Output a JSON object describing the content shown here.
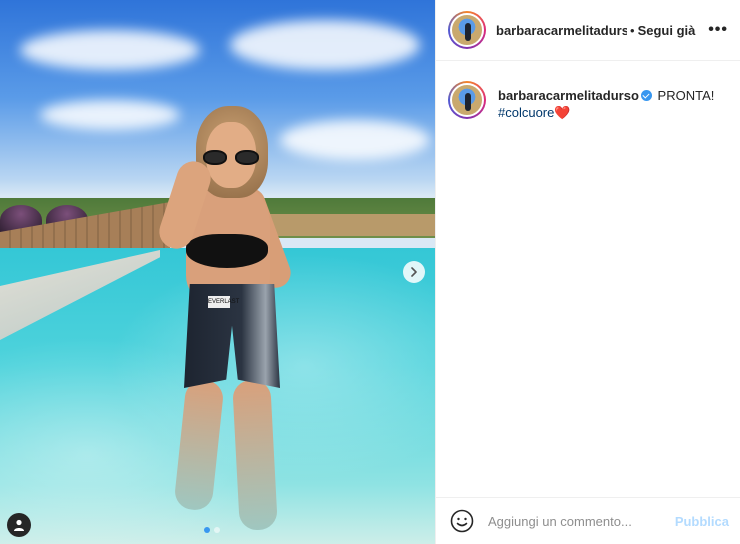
{
  "post": {
    "username": "barbaracarmelitadurso",
    "separator": "•",
    "follow_label": "Segui già",
    "more_label": "•••",
    "caption_text": "PRONTA!",
    "hashtag": "#colcuore",
    "heart": "❤️",
    "shorts_label": "EVERLAST"
  },
  "carousel": {
    "slides": 2,
    "active": 1
  },
  "comment": {
    "placeholder": "Aggiungi un commento...",
    "publish_label": "Pubblica"
  },
  "colors": {
    "accent": "#3897f0",
    "publish_disabled": "#b3dbff",
    "hashtag": "#00376b"
  },
  "icons": [
    "chevron-right-icon",
    "user-tag-icon",
    "emoji-icon",
    "verified-badge-icon",
    "more-icon"
  ]
}
